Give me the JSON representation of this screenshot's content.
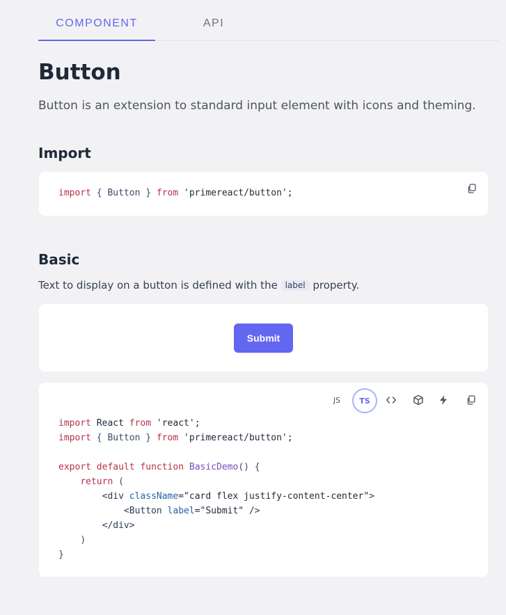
{
  "tabs": [
    {
      "label": "COMPONENT",
      "active": true
    },
    {
      "label": "API",
      "active": false
    }
  ],
  "page": {
    "title": "Button",
    "description": "Button is an extension to standard input element with icons and theming."
  },
  "import_section": {
    "title": "Import",
    "code": {
      "kw": "import",
      "mid": " { Button } ",
      "from": "from",
      "module": " 'primereact/button';"
    }
  },
  "basic_section": {
    "title": "Basic",
    "desc_before": "Text to display on a button is defined with the ",
    "desc_code": "label",
    "desc_after": " property.",
    "button_label": "Submit",
    "toolbar": {
      "js": "JS",
      "ts": "TS",
      "active": "TS",
      "icons": [
        "code-icon",
        "box-icon",
        "bolt-icon",
        "copy-icon"
      ]
    }
  },
  "colors": {
    "accent": "#6366f1",
    "background": "#f2f2f5",
    "card": "#ffffff",
    "keyword": "#c2185b"
  }
}
